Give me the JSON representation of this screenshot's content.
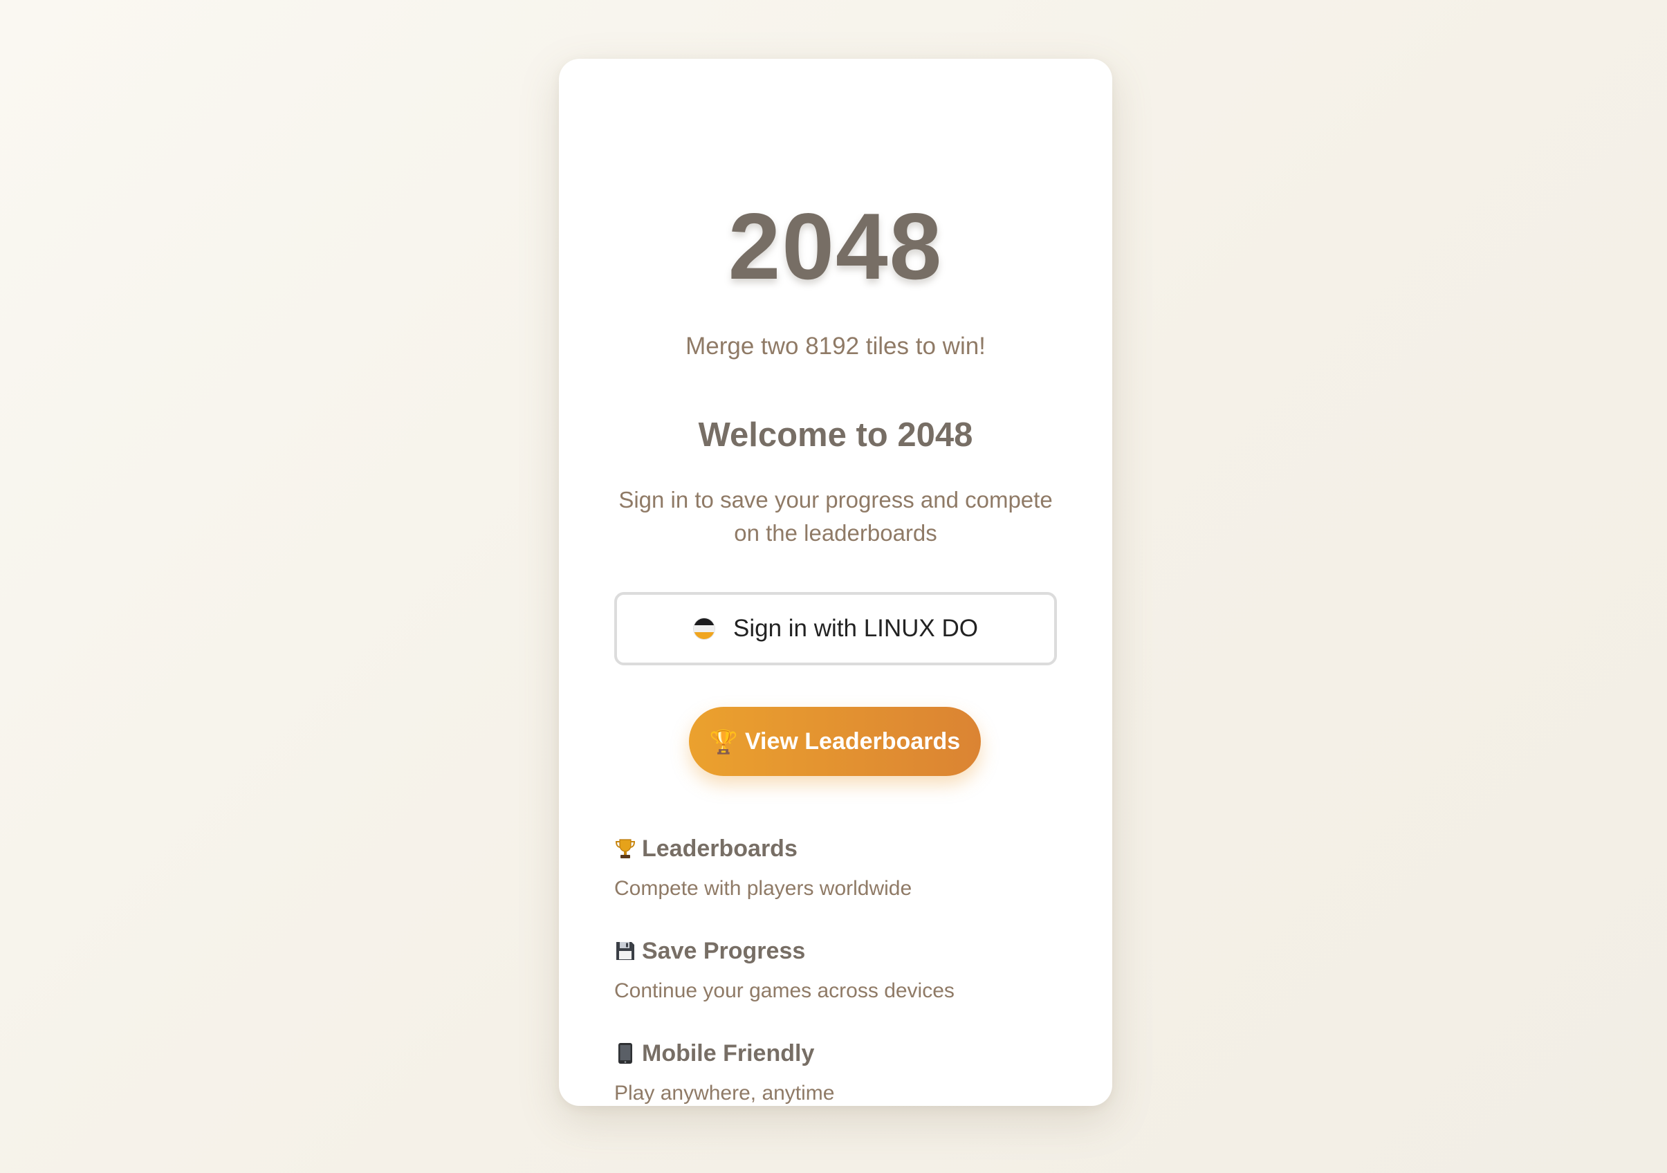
{
  "header": {
    "logo": "2048",
    "subtitle": "Merge two 8192 tiles to win!"
  },
  "auth": {
    "welcome": "Welcome to 2048",
    "description": "Sign in to save your progress and compete on the leaderboards",
    "signin_label": "Sign in with LINUX DO",
    "signin_icon": "linux-do-logo-icon"
  },
  "leaderboard_button": {
    "icon": "🏆",
    "label": "View Leaderboards"
  },
  "features": [
    {
      "icon": "trophy-icon",
      "title": "Leaderboards",
      "desc": "Compete with players worldwide"
    },
    {
      "icon": "floppy-disk-icon",
      "title": "Save Progress",
      "desc": "Continue your games across devices"
    },
    {
      "icon": "mobile-phone-icon",
      "title": "Mobile Friendly",
      "desc": "Play anywhere, anytime"
    }
  ],
  "colors": {
    "title": "#776e65",
    "text": "#8f7a66",
    "accent_start": "#eba12e",
    "accent_end": "#db8433",
    "background": "#f7f4ec"
  }
}
